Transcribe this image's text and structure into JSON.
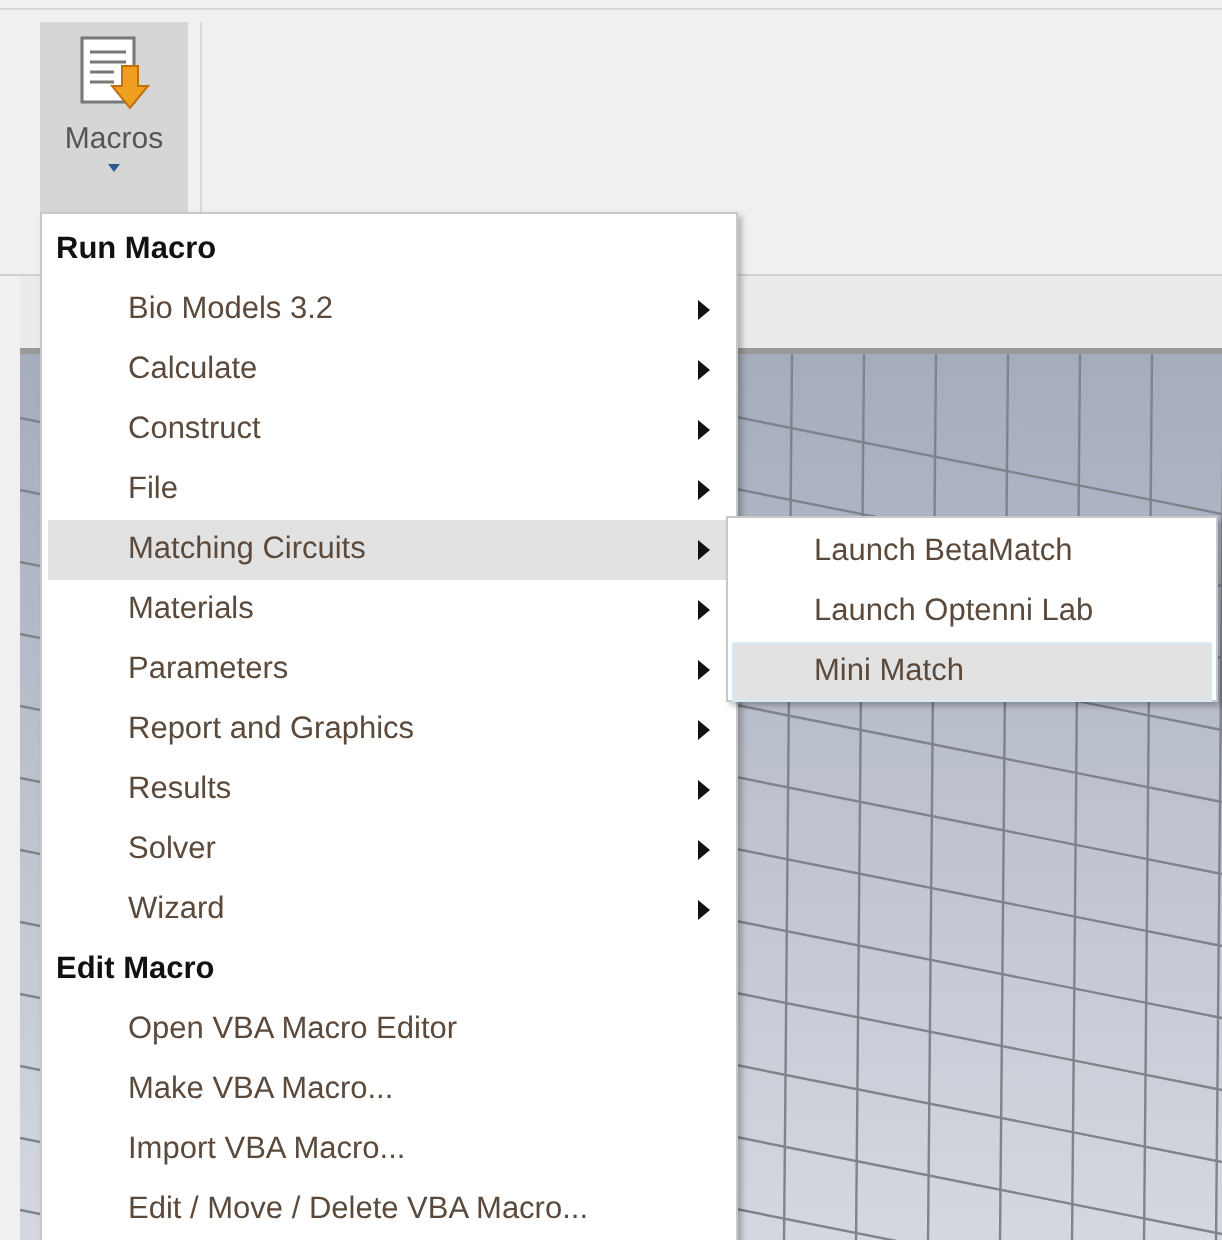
{
  "ribbon": {
    "macros_button": {
      "label": "Macros",
      "pressed": true
    }
  },
  "menu": {
    "sections": [
      {
        "header": "Run Macro",
        "items": [
          {
            "label": "Bio Models 3.2",
            "has_submenu": true,
            "selected": false
          },
          {
            "label": "Calculate",
            "has_submenu": true,
            "selected": false
          },
          {
            "label": "Construct",
            "has_submenu": true,
            "selected": false
          },
          {
            "label": "File",
            "has_submenu": true,
            "selected": false
          },
          {
            "label": "Matching Circuits",
            "has_submenu": true,
            "selected": true
          },
          {
            "label": "Materials",
            "has_submenu": true,
            "selected": false
          },
          {
            "label": "Parameters",
            "has_submenu": true,
            "selected": false
          },
          {
            "label": "Report and Graphics",
            "has_submenu": true,
            "selected": false
          },
          {
            "label": "Results",
            "has_submenu": true,
            "selected": false
          },
          {
            "label": "Solver",
            "has_submenu": true,
            "selected": false
          },
          {
            "label": "Wizard",
            "has_submenu": true,
            "selected": false
          }
        ]
      },
      {
        "header": "Edit Macro",
        "items": [
          {
            "label": "Open VBA Macro Editor",
            "has_submenu": false,
            "selected": false
          },
          {
            "label": "Make VBA Macro...",
            "has_submenu": false,
            "selected": false
          },
          {
            "label": "Import VBA Macro...",
            "has_submenu": false,
            "selected": false
          },
          {
            "label": "Edit / Move / Delete VBA Macro...",
            "has_submenu": false,
            "selected": false
          }
        ]
      }
    ]
  },
  "submenu": {
    "items": [
      {
        "label": "Launch BetaMatch",
        "selected": false
      },
      {
        "label": "Launch Optenni Lab",
        "selected": false
      },
      {
        "label": "Mini Match",
        "selected": true
      }
    ]
  }
}
